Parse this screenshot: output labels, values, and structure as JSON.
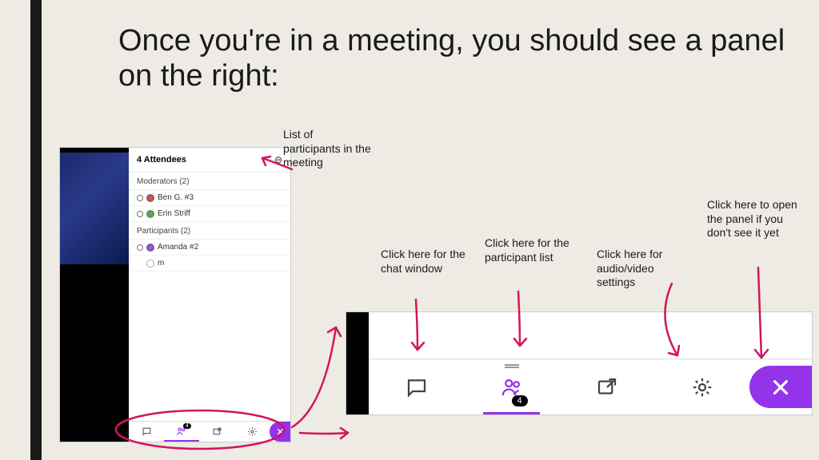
{
  "title": "Once you're in a meeting, you should see a panel on the right:",
  "panel": {
    "attendees_label": "4 Attendees",
    "moderators_label": "Moderators (2)",
    "participants_label": "Participants (2)",
    "mod1": "Ben G. #3",
    "mod2": "Erin Striff",
    "part1": "Amanda #2",
    "part2": "m"
  },
  "callouts": {
    "list": "List of participants in the meeting",
    "chat": "Click here for the chat window",
    "participants": "Click here for the participant list",
    "av": "Click here for audio/video settings",
    "open": "Click here to open the panel if you don't see it yet"
  },
  "toolbar": {
    "count": "4"
  }
}
